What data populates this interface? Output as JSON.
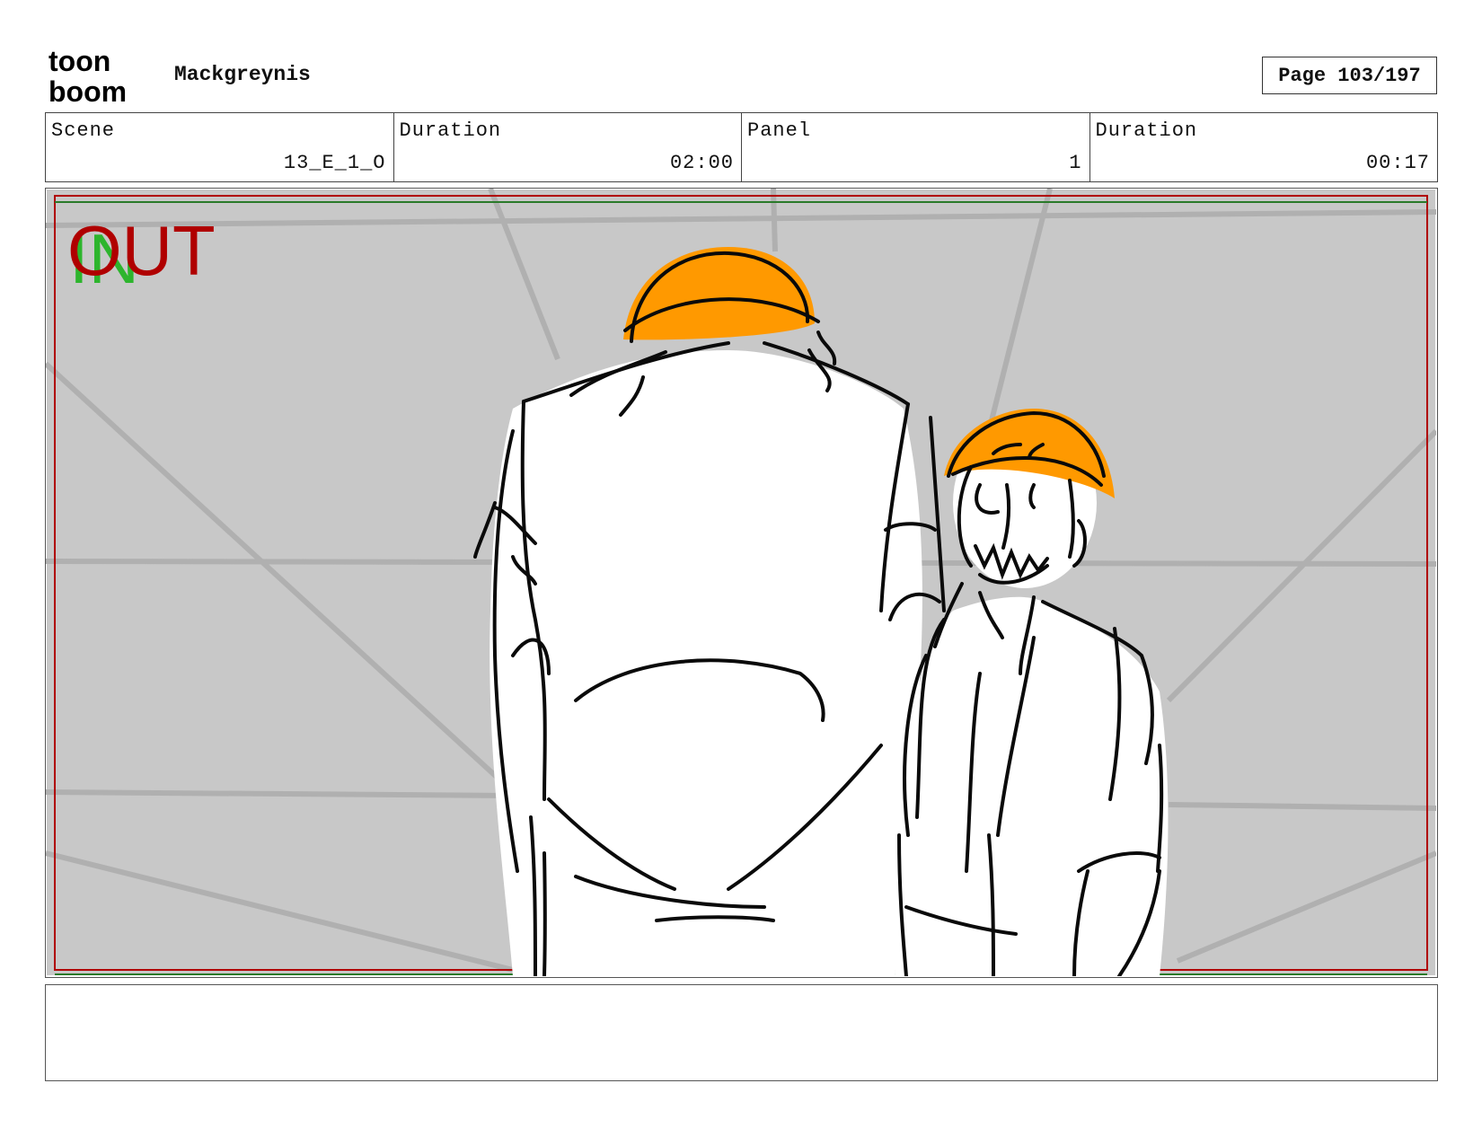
{
  "header": {
    "logo_text_top": "toon",
    "logo_text_bottom": "boom",
    "project_title": "Mackgreynis",
    "page_label": "Page 103/197"
  },
  "info": {
    "scene_label": "Scene",
    "scene_value": "13_E_1_O",
    "scene_duration_label": "Duration",
    "scene_duration_value": "02:00",
    "panel_label": "Panel",
    "panel_value": "1",
    "panel_duration_label": "Duration",
    "panel_duration_value": "00:17"
  },
  "panel": {
    "in_marker": "IN",
    "out_marker": "OUT",
    "in_color": "#2db52d",
    "out_color": "#b00000",
    "hat_color": "#ff9900",
    "background_color": "#c8c8c8"
  },
  "notes": {
    "text": ""
  }
}
